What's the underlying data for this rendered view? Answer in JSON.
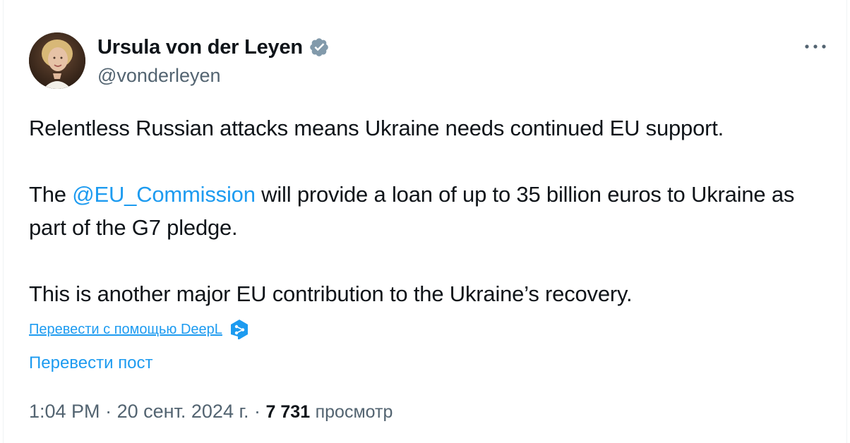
{
  "author": {
    "display_name": "Ursula von der Leyen",
    "handle": "@vonderleyen",
    "verified_color": "#829aab"
  },
  "tweet": {
    "line1": "Relentless Russian attacks means Ukraine needs continued EU support.",
    "p2_prefix": "The ",
    "mention": "@EU_Commission",
    "p2_suffix": " will provide a loan of up to 35 billion euros to Ukraine as part of the G7 pledge.",
    "line3": "This is another major EU contribution to the Ukraine’s recovery."
  },
  "translate": {
    "deepl_label": "Перевести с помощью DeepL",
    "post_label": "Перевести пост"
  },
  "meta": {
    "time": "1:04 PM",
    "date": "20 сент. 2024 г.",
    "separator": " · ",
    "views_count": "7 731",
    "views_label": "просмотр"
  },
  "colors": {
    "link": "#1d9bf0",
    "secondary": "#536471",
    "text": "#0f1419"
  },
  "icons": {
    "more": "more-dots-icon",
    "verified": "verified-badge-icon",
    "deepl": "deepl-logo-icon"
  }
}
